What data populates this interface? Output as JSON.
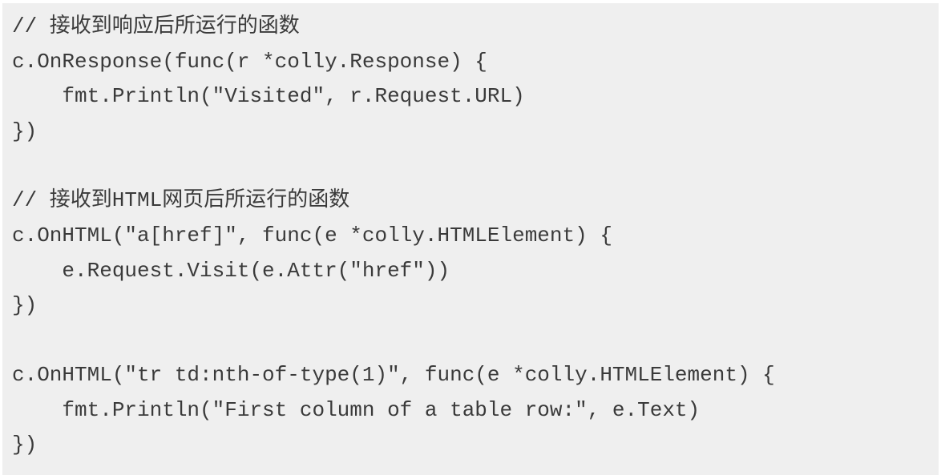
{
  "code": {
    "lines": [
      "// 接收到响应后所运行的函数",
      "c.OnResponse(func(r *colly.Response) {",
      "    fmt.Println(\"Visited\", r.Request.URL)",
      "})",
      "",
      "// 接收到HTML网页后所运行的函数",
      "c.OnHTML(\"a[href]\", func(e *colly.HTMLElement) {",
      "    e.Request.Visit(e.Attr(\"href\"))",
      "})",
      "",
      "c.OnHTML(\"tr td:nth-of-type(1)\", func(e *colly.HTMLElement) {",
      "    fmt.Println(\"First column of a table row:\", e.Text)",
      "})"
    ]
  }
}
